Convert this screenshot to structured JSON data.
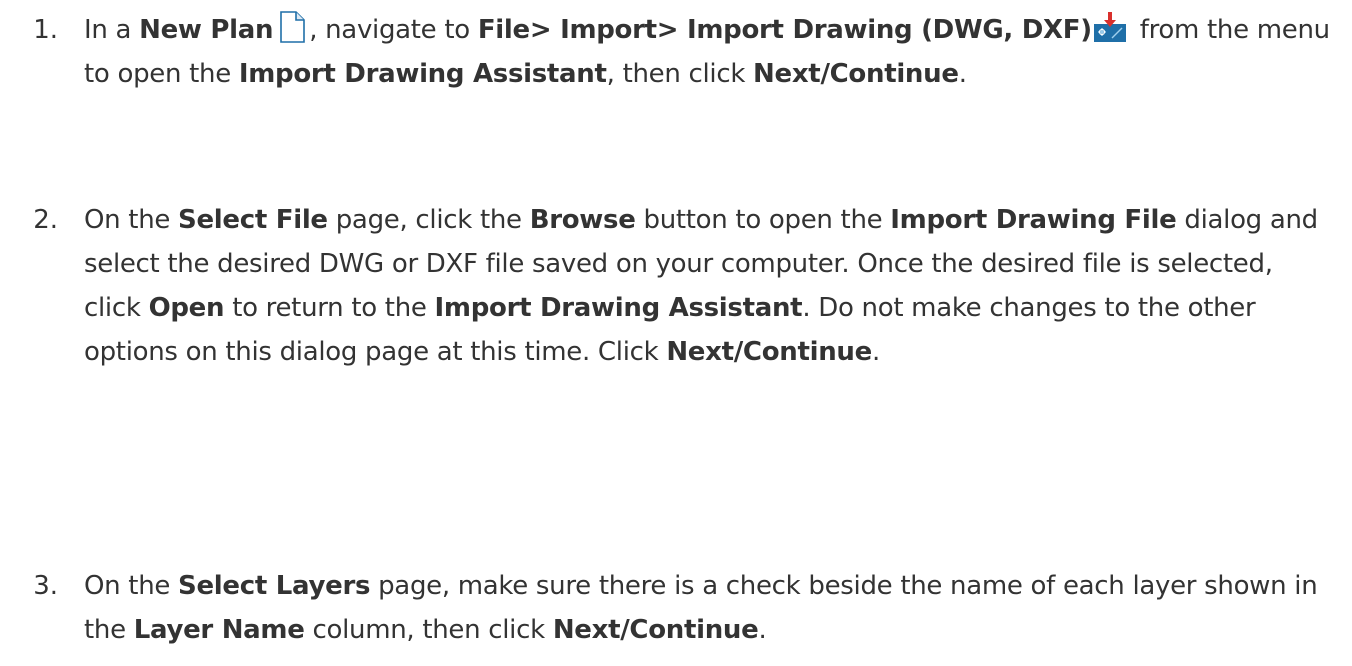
{
  "steps": [
    {
      "number": "1.",
      "parts": {
        "p1": "In a ",
        "b1": "New Plan",
        "p2": ", navigate to ",
        "b2": "File> Import> Import Drawing (DWG, DXF)",
        "p3": " from the menu to open the ",
        "b3": "Import Drawing Assistant",
        "p4": ", then click ",
        "b4": "Next/Continue",
        "p5": "."
      },
      "icons": [
        "new-plan-icon",
        "import-drawing-icon"
      ]
    },
    {
      "number": "2.",
      "parts": {
        "p1": "On the ",
        "b1": "Select File",
        "p2": " page, click the ",
        "b2": "Browse",
        "p3": " button to open the ",
        "b3": "Import Drawing File",
        "p4": " dialog and select the desired DWG or DXF file saved on your computer. Once the desired file is selected, click ",
        "b4": "Open",
        "p5": " to return to the ",
        "b5": "Import Drawing Assistant",
        "p6": ". Do not make changes to the other options on this dialog page at this time. Click ",
        "b6": "Next/Continue",
        "p7": "."
      }
    },
    {
      "number": "3.",
      "parts": {
        "p1": "On the ",
        "b1": "Select Layers",
        "p2": " page, make sure there is a check beside the name of each layer shown in the ",
        "b2": "Layer Name",
        "p3": " column, then click ",
        "b3": "Next/Continue",
        "p4": "."
      }
    }
  ],
  "colors": {
    "text": "#333333",
    "icon_blue": "#1f6fa8",
    "icon_red": "#d9302c"
  }
}
